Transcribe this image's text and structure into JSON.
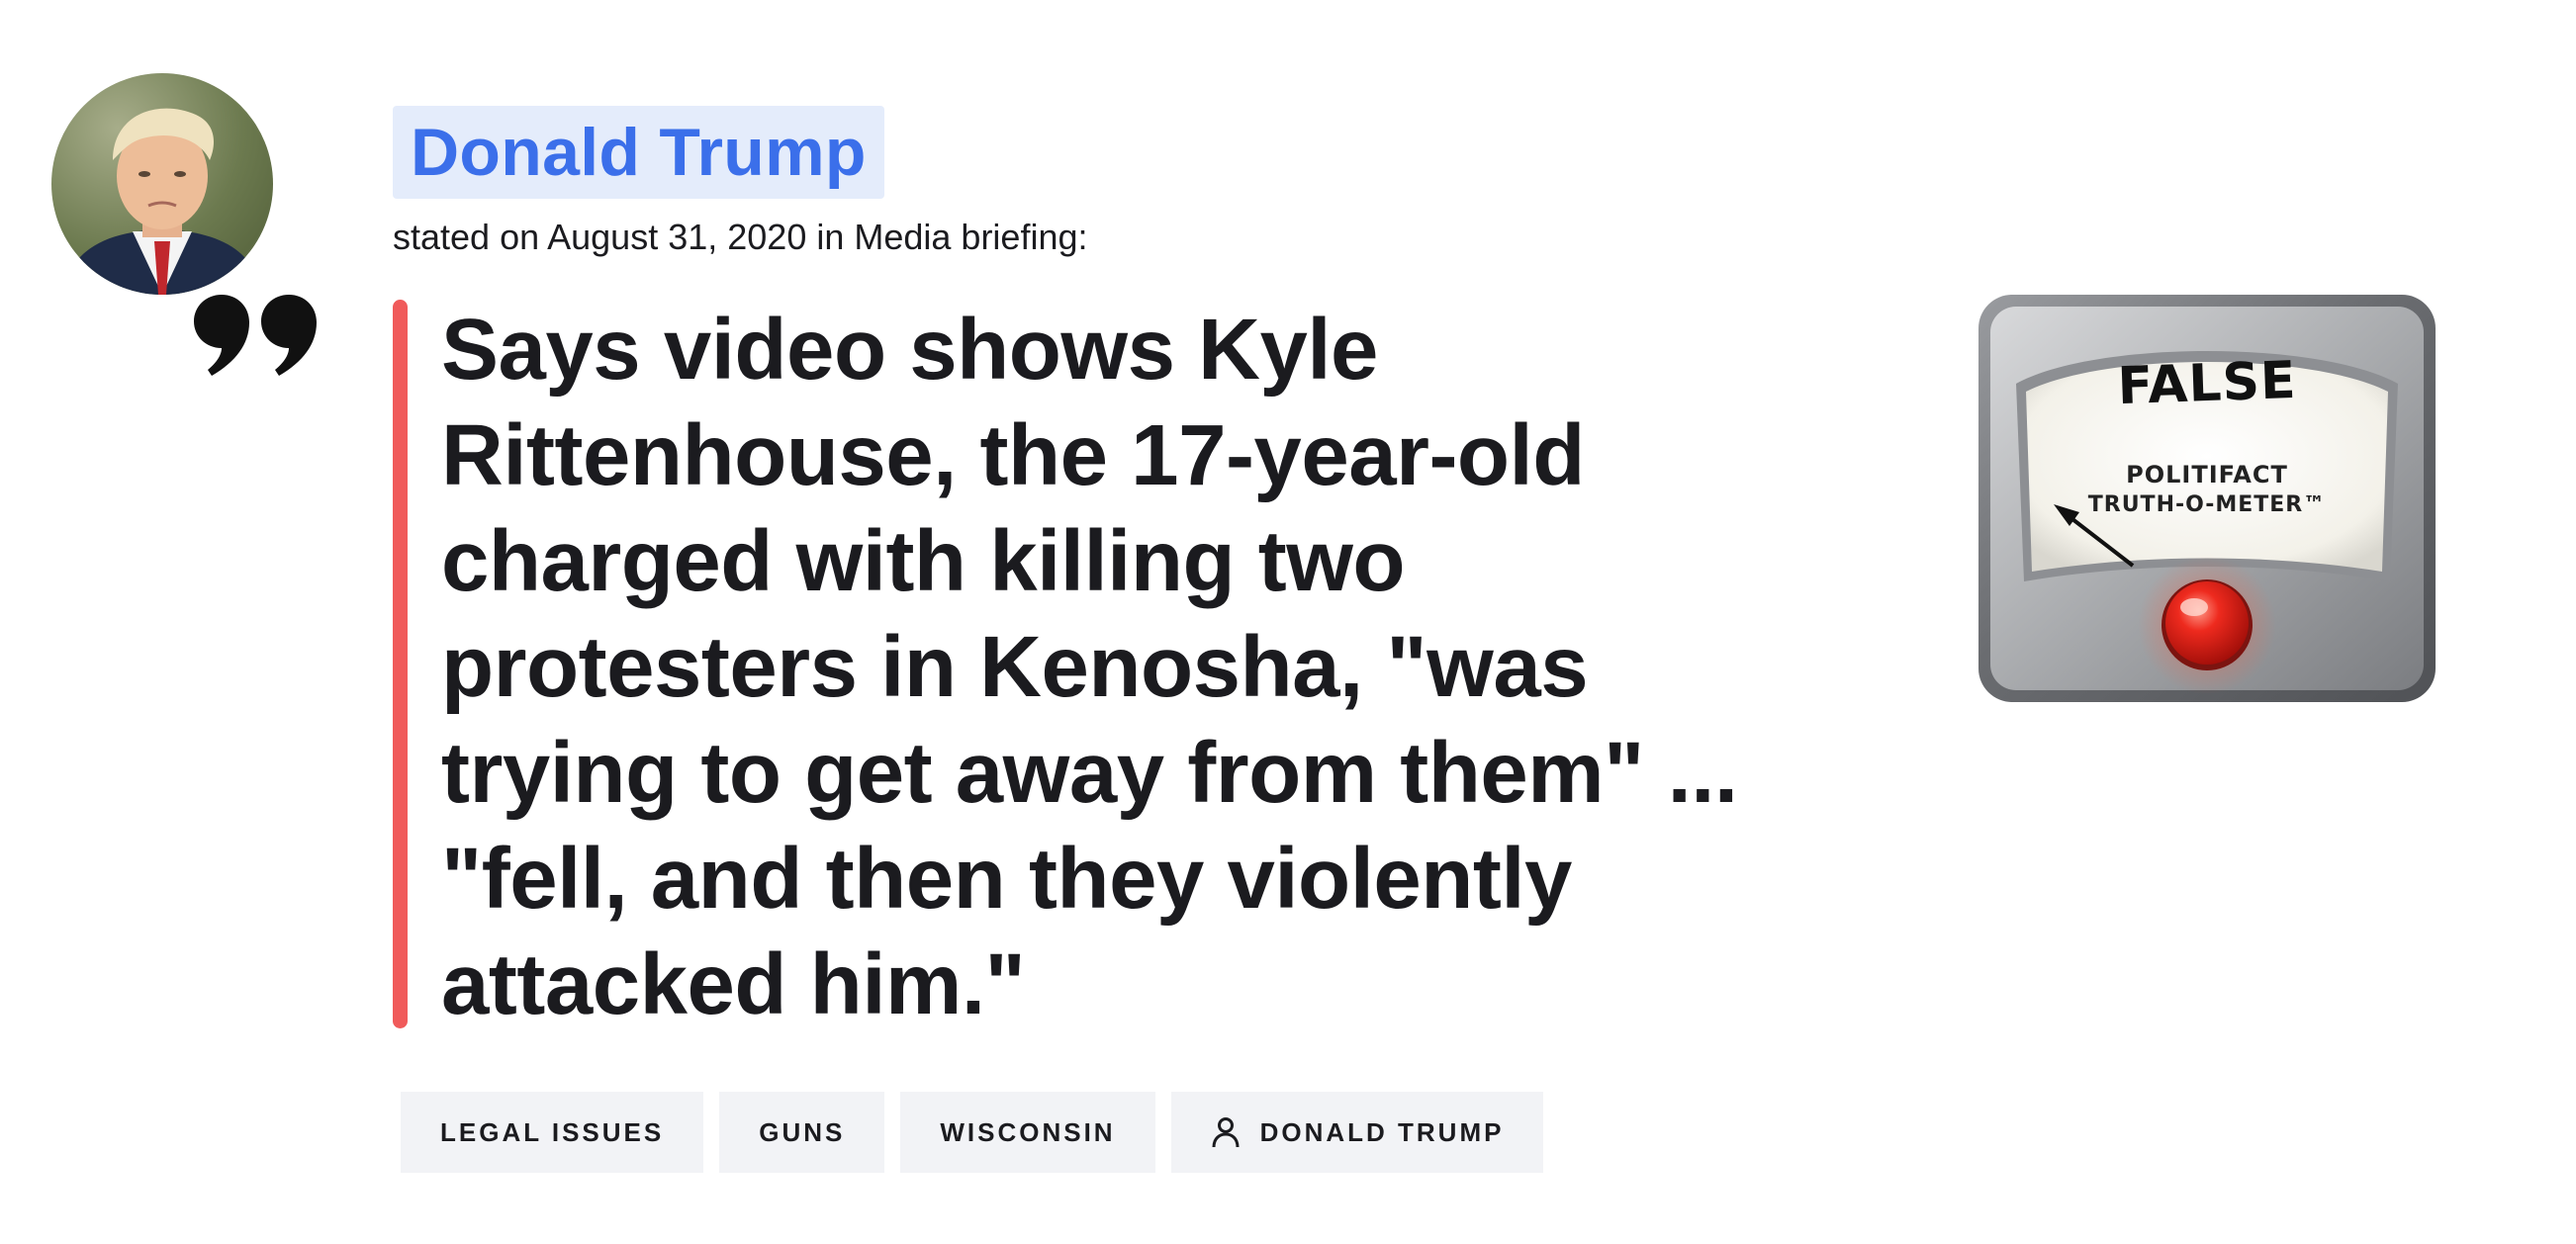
{
  "speaker": {
    "name": "Donald Trump",
    "stated_line": "stated on August 31, 2020 in Media briefing:"
  },
  "statement": {
    "text": "Says video shows Kyle Rittenhouse, the 17-year-old charged with killing two protesters in Kenosha, \"was trying to get away from them\" ... \"fell, and then they violently attacked him.\""
  },
  "tags": [
    {
      "label": "LEGAL ISSUES"
    },
    {
      "label": "GUNS"
    },
    {
      "label": "WISCONSIN"
    },
    {
      "label": "DONALD TRUMP",
      "icon": "person-icon"
    }
  ],
  "meter": {
    "rating": "FALSE",
    "brand_line_1": "POLITIFACT",
    "brand_line_2": "TRUTH-O-METER™",
    "icon": "truth-o-meter-dial"
  },
  "colors": {
    "accent_blue": "#3b6fea",
    "name_highlight": "#e4ecfb",
    "quote_bar": "#f05a5a",
    "tag_background": "#f2f3f6",
    "meter_button": "#e21d1d"
  }
}
